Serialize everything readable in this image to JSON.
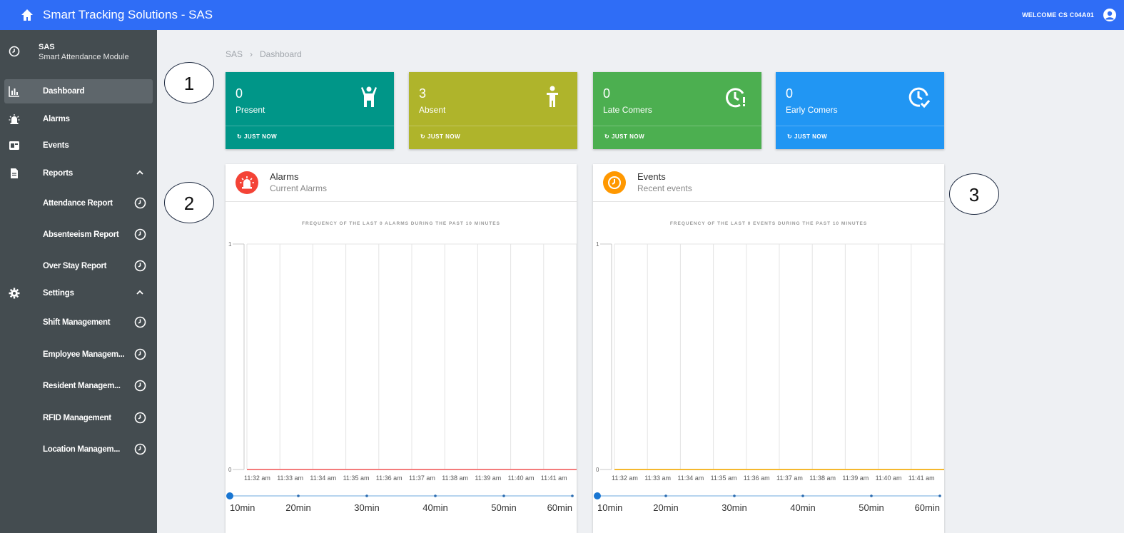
{
  "topbar": {
    "title": "Smart Tracking Solutions - SAS",
    "welcome": "WELCOME CS C04A01"
  },
  "sidebar": {
    "app_name": "SAS",
    "app_subtitle": "Smart Attendance Module",
    "items": [
      {
        "label": "Dashboard",
        "icon": "bar-chart-icon"
      },
      {
        "label": "Alarms",
        "icon": "siren-icon"
      },
      {
        "label": "Events",
        "icon": "calendar-icon"
      },
      {
        "label": "Reports",
        "icon": "document-icon"
      }
    ],
    "reports": [
      "Attendance Report",
      "Absenteeism Report",
      "Over Stay Report"
    ],
    "settings_label": "Settings",
    "settings": [
      "Shift Management",
      "Employee Managem...",
      "Resident Managem...",
      "RFID Management",
      "Location Managem..."
    ]
  },
  "breadcrumb": {
    "root": "SAS",
    "sep": "›",
    "page": "Dashboard"
  },
  "callouts": [
    "1",
    "2",
    "3"
  ],
  "tiles": [
    {
      "value": "0",
      "label": "Present",
      "footer": "JUST NOW",
      "color": "#009688"
    },
    {
      "value": "3",
      "label": "Absent",
      "footer": "JUST NOW",
      "color": "#afb42b"
    },
    {
      "value": "0",
      "label": "Late Comers",
      "footer": "JUST NOW",
      "color": "#4caf50"
    },
    {
      "value": "0",
      "label": "Early Comers",
      "footer": "JUST NOW",
      "color": "#2196f3"
    }
  ],
  "alarms_card": {
    "title": "Alarms",
    "subtitle": "Current Alarms",
    "badge_color": "#f44336",
    "chart_title": "FREQUENCY OF THE LAST 0 ALARMS DURING THE PAST 10 MINUTES",
    "line_color": "#f47c7c"
  },
  "events_card": {
    "title": "Events",
    "subtitle": "Recent events",
    "badge_color": "#ff9800",
    "chart_title": "FREQUENCY OF THE LAST 0 EVENTS DURING THE PAST 10 MINUTES",
    "line_color": "#f5b82e"
  },
  "range_labels": [
    "10min",
    "20min",
    "30min",
    "40min",
    "50min",
    "60min"
  ],
  "chart_data": [
    {
      "type": "line",
      "categories": [
        "11:32 am",
        "11:33 am",
        "11:34 am",
        "11:35 am",
        "11:36 am",
        "11:37 am",
        "11:38 am",
        "11:39 am",
        "11:40 am",
        "11:41 am"
      ],
      "values": [
        0,
        0,
        0,
        0,
        0,
        0,
        0,
        0,
        0,
        0
      ],
      "yticks": [
        "0",
        "1"
      ],
      "ylim": [
        0,
        1
      ],
      "grid": true
    },
    {
      "type": "line",
      "categories": [
        "11:32 am",
        "11:33 am",
        "11:34 am",
        "11:35 am",
        "11:36 am",
        "11:37 am",
        "11:38 am",
        "11:39 am",
        "11:40 am",
        "11:41 am"
      ],
      "values": [
        0,
        0,
        0,
        0,
        0,
        0,
        0,
        0,
        0,
        0
      ],
      "yticks": [
        "0",
        "1"
      ],
      "ylim": [
        0,
        1
      ],
      "grid": true
    }
  ]
}
